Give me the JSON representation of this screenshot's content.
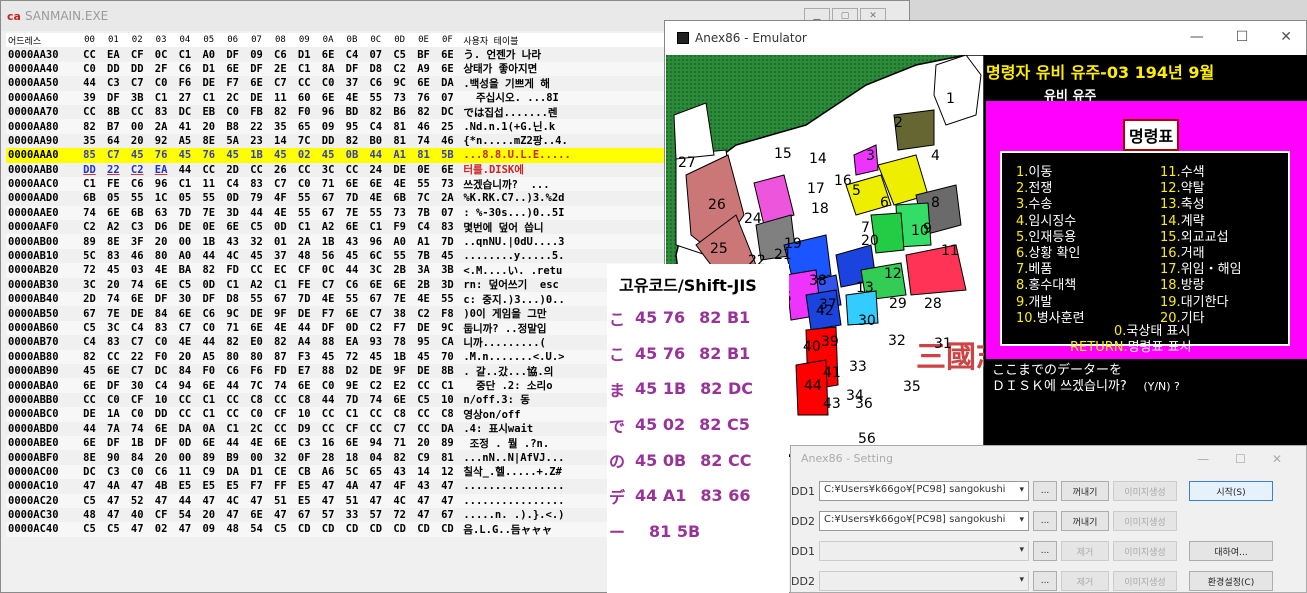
{
  "hexwin": {
    "title": "SANMAIN.EXE",
    "logo": "ca",
    "header": {
      "addr": "어드레스",
      "cols": [
        "00",
        "01",
        "02",
        "03",
        "04",
        "05",
        "06",
        "07",
        "08",
        "09",
        "0A",
        "0B",
        "0C",
        "0D",
        "0E",
        "0F"
      ],
      "ascii": "사용자 테이블"
    },
    "rows": [
      {
        "addr": "0000AA30",
        "b": [
          "CC",
          "EA",
          "CF",
          "0C",
          "C1",
          "A0",
          "DF",
          "09",
          "C6",
          "D1",
          "6E",
          "C4",
          "07",
          "C5",
          "BF",
          "6E"
        ],
        "a": "う. 언젠가 나라"
      },
      {
        "addr": "0000AA40",
        "b": [
          "C0",
          "DD",
          "DD",
          "2F",
          "C6",
          "D1",
          "6E",
          "DF",
          "2E",
          "C1",
          "8A",
          "DF",
          "D8",
          "C2",
          "A9",
          "6E"
        ],
        "a": "상태가 좋아지면"
      },
      {
        "addr": "0000AA50",
        "b": [
          "44",
          "C3",
          "C7",
          "C0",
          "F6",
          "DE",
          "F7",
          "6E",
          "C7",
          "CC",
          "C0",
          "37",
          "C6",
          "9C",
          "6E",
          "DA"
        ],
        "a": ".백성을 기쁘게 해"
      },
      {
        "addr": "0000AA60",
        "b": [
          "39",
          "DF",
          "3B",
          "C1",
          "27",
          "C1",
          "2C",
          "DE",
          "11",
          "60",
          "6E",
          "4E",
          "55",
          "73",
          "76",
          "07"
        ],
        "a": "  주십시오. ...8I"
      },
      {
        "addr": "0000AA70",
        "b": [
          "CC",
          "8B",
          "CC",
          "83",
          "DC",
          "EB",
          "C0",
          "FB",
          "82",
          "F0",
          "96",
          "BD",
          "82",
          "B6",
          "82",
          "DC"
        ],
        "a": "では집섭.......렌"
      },
      {
        "addr": "0000AA80",
        "b": [
          "82",
          "B7",
          "00",
          "2A",
          "41",
          "20",
          "B8",
          "22",
          "35",
          "65",
          "09",
          "95",
          "C4",
          "81",
          "46",
          "25"
        ],
        "a": ".Nd.n.1(+G.닌.k"
      },
      {
        "addr": "0000AA90",
        "b": [
          "35",
          "64",
          "20",
          "92",
          "A5",
          "8E",
          "5A",
          "23",
          "14",
          "7C",
          "DD",
          "82",
          "B0",
          "81",
          "74",
          "46"
        ],
        "a": "{*n.....mZ2팡..4."
      },
      {
        "addr": "0000AAA0",
        "b": [
          "85",
          "C7",
          "45",
          "76",
          "45",
          "76",
          "45",
          "1B",
          "45",
          "02",
          "45",
          "0B",
          "44",
          "A1",
          "81",
          "5B"
        ],
        "a": "...8.8.U.L.E.....",
        "cls": "sel"
      },
      {
        "addr": "0000AAB0",
        "b": [
          "DD",
          "22",
          "C2",
          "EA",
          "44",
          "CC",
          "2D",
          "CC",
          "26",
          "CC",
          "3C",
          "CC",
          "24",
          "DE",
          "0E",
          "6E"
        ],
        "a": "터를.DISK에",
        "cls": "sel2"
      },
      {
        "addr": "0000AAC0",
        "b": [
          "C1",
          "FE",
          "C6",
          "96",
          "C1",
          "11",
          "C4",
          "83",
          "C7",
          "C0",
          "71",
          "6E",
          "6E",
          "4E",
          "55",
          "73"
        ],
        "a": "쓰겠습니까?  ..."
      },
      {
        "addr": "0000AAD0",
        "b": [
          "6B",
          "05",
          "55",
          "1C",
          "05",
          "55",
          "0D",
          "79",
          "4F",
          "55",
          "67",
          "7D",
          "4E",
          "6B",
          "7C",
          "2A"
        ],
        "a": "%K.RK.C7..)3.%2d"
      },
      {
        "addr": "0000AAE0",
        "b": [
          "74",
          "6E",
          "6B",
          "63",
          "7D",
          "7E",
          "3D",
          "44",
          "4E",
          "55",
          "67",
          "7E",
          "55",
          "73",
          "7B",
          "07"
        ],
        "a": ": %-30s...)0..5I"
      },
      {
        "addr": "0000AAF0",
        "b": [
          "C2",
          "A2",
          "C3",
          "D6",
          "DE",
          "0E",
          "6E",
          "C5",
          "0D",
          "C1",
          "A2",
          "6E",
          "C1",
          "F9",
          "C4",
          "83"
        ],
        "a": "몇번에 덮어 씁니"
      },
      {
        "addr": "0000AB00",
        "b": [
          "89",
          "8E",
          "3F",
          "20",
          "00",
          "1B",
          "43",
          "32",
          "01",
          "2A",
          "1B",
          "43",
          "96",
          "A0",
          "A1",
          "7D"
        ],
        "a": "..qnNU.|0dU....3"
      },
      {
        "addr": "0000AB10",
        "b": [
          "5C",
          "83",
          "46",
          "80",
          "A0",
          "44",
          "4C",
          "45",
          "37",
          "48",
          "56",
          "45",
          "6C",
          "55",
          "7B",
          "45"
        ],
        "a": "........y.....5."
      },
      {
        "addr": "0000AB20",
        "b": [
          "72",
          "45",
          "03",
          "4E",
          "BA",
          "82",
          "FD",
          "CC",
          "EC",
          "CF",
          "0C",
          "44",
          "3C",
          "2B",
          "3A",
          "3B"
        ],
        "a": "<.M....い. .retu"
      },
      {
        "addr": "0000AB30",
        "b": [
          "3C",
          "20",
          "74",
          "6E",
          "C5",
          "0D",
          "C1",
          "A2",
          "C1",
          "FE",
          "C7",
          "C6",
          "6E",
          "6E",
          "2B",
          "3D"
        ],
        "a": "rn: 덮어쓰기  esc"
      },
      {
        "addr": "0000AB40",
        "b": [
          "2D",
          "74",
          "6E",
          "DF",
          "30",
          "DF",
          "D8",
          "55",
          "67",
          "7D",
          "4E",
          "55",
          "67",
          "7E",
          "4E",
          "55"
        ],
        "a": "c: 중지.)3...)0.."
      },
      {
        "addr": "0000AB50",
        "b": [
          "67",
          "7E",
          "DE",
          "84",
          "6E",
          "C6",
          "9C",
          "DE",
          "9F",
          "DE",
          "F7",
          "6E",
          "C7",
          "38",
          "C2",
          "F8"
        ],
        "a": ")0이 게임을 그만"
      },
      {
        "addr": "0000AB60",
        "b": [
          "C5",
          "3C",
          "C4",
          "83",
          "C7",
          "C0",
          "71",
          "6E",
          "4E",
          "44",
          "DF",
          "0D",
          "C2",
          "F7",
          "DE",
          "9C"
        ],
        "a": "둡니까? ..정말입"
      },
      {
        "addr": "0000AB70",
        "b": [
          "C4",
          "83",
          "C7",
          "C0",
          "4E",
          "44",
          "82",
          "E0",
          "82",
          "A4",
          "88",
          "EA",
          "93",
          "78",
          "95",
          "CA"
        ],
        "a": "니까.........("
      },
      {
        "addr": "0000AB80",
        "b": [
          "82",
          "CC",
          "22",
          "F0",
          "20",
          "A5",
          "80",
          "80",
          "87",
          "F3",
          "45",
          "72",
          "45",
          "1B",
          "45",
          "70"
        ],
        "a": ".M.n.......<.U.>"
      },
      {
        "addr": "0000AB90",
        "b": [
          "45",
          "6E",
          "C7",
          "DC",
          "84",
          "F0",
          "C6",
          "F6",
          "FD",
          "E7",
          "88",
          "D2",
          "DE",
          "9F",
          "DE",
          "8B"
        ],
        "a": ". 갈..갔...協.의"
      },
      {
        "addr": "0000ABA0",
        "b": [
          "6E",
          "DF",
          "30",
          "C4",
          "94",
          "6E",
          "44",
          "7C",
          "74",
          "6E",
          "C0",
          "9E",
          "C2",
          "E2",
          "CC",
          "C1"
        ],
        "a": "  중단 .2: 소리o"
      },
      {
        "addr": "0000ABB0",
        "b": [
          "CC",
          "C0",
          "CF",
          "10",
          "CC",
          "C1",
          "CC",
          "C8",
          "CC",
          "C8",
          "44",
          "7D",
          "74",
          "6E",
          "C5",
          "10"
        ],
        "a": "n/off.3: 동"
      },
      {
        "addr": "0000ABC0",
        "b": [
          "DE",
          "1A",
          "C0",
          "DD",
          "CC",
          "C1",
          "CC",
          "C0",
          "CF",
          "10",
          "CC",
          "C1",
          "CC",
          "C8",
          "CC",
          "C8"
        ],
        "a": "영상on/off"
      },
      {
        "addr": "0000ABD0",
        "b": [
          "44",
          "7A",
          "74",
          "6E",
          "DA",
          "0A",
          "C1",
          "2C",
          "CC",
          "D9",
          "CC",
          "CF",
          "CC",
          "C7",
          "CC",
          "DA"
        ],
        "a": ".4: 표시wait"
      },
      {
        "addr": "0000ABE0",
        "b": [
          "6E",
          "DF",
          "1B",
          "DF",
          "0D",
          "6E",
          "44",
          "4E",
          "6E",
          "C3",
          "16",
          "6E",
          "94",
          "71",
          "20",
          "89"
        ],
        "a": " 조정 . 뭘 .?n."
      },
      {
        "addr": "0000ABF0",
        "b": [
          "8E",
          "90",
          "84",
          "20",
          "00",
          "89",
          "B9",
          "00",
          "32",
          "0F",
          "28",
          "18",
          "04",
          "82",
          "C9",
          "81"
        ],
        "a": "...nN..N|AfVJ..."
      },
      {
        "addr": "0000AC00",
        "b": [
          "DC",
          "C3",
          "C0",
          "C6",
          "11",
          "C9",
          "DA",
          "D1",
          "CE",
          "CB",
          "A6",
          "5C",
          "65",
          "43",
          "14",
          "12"
        ],
        "a": "칠삭_.헬.....+.Z#"
      },
      {
        "addr": "0000AC10",
        "b": [
          "47",
          "4A",
          "47",
          "4B",
          "E5",
          "E5",
          "E5",
          "F7",
          "FF",
          "E5",
          "47",
          "4A",
          "47",
          "4F",
          "43",
          "47"
        ],
        "a": "................"
      },
      {
        "addr": "0000AC20",
        "b": [
          "C5",
          "47",
          "52",
          "47",
          "44",
          "47",
          "4C",
          "47",
          "51",
          "E5",
          "47",
          "51",
          "47",
          "4C",
          "47",
          "47"
        ],
        "a": "................"
      },
      {
        "addr": "0000AC30",
        "b": [
          "48",
          "47",
          "40",
          "CF",
          "54",
          "20",
          "47",
          "6E",
          "47",
          "67",
          "57",
          "33",
          "57",
          "72",
          "47",
          "67"
        ],
        "a": ".....n. .).}.<.)"
      },
      {
        "addr": "0000AC40",
        "b": [
          "C5",
          "C5",
          "47",
          "02",
          "47",
          "09",
          "48",
          "54",
          "C5",
          "CD",
          "CD",
          "CD",
          "CD",
          "CD",
          "CD",
          "CD"
        ],
        "a": "음.L.G..듬ャャャ"
      }
    ]
  },
  "emulator": {
    "title": "Anex86 - Emulator",
    "hud_line1": "명령자 유비  유주-03  194년  9월",
    "hud_line2": "유비    유주",
    "menu_title": "명령표",
    "menu_left": [
      {
        "n": "1.",
        "t": "이동"
      },
      {
        "n": "2.",
        "t": "전쟁"
      },
      {
        "n": "3.",
        "t": "수송"
      },
      {
        "n": "4.",
        "t": "임시징수"
      },
      {
        "n": "5.",
        "t": "인재등용"
      },
      {
        "n": "6.",
        "t": "상황 확인"
      },
      {
        "n": "7.",
        "t": "베품"
      },
      {
        "n": "8.",
        "t": "홍수대책"
      },
      {
        "n": "9.",
        "t": "개발"
      },
      {
        "n": "10.",
        "t": "병사훈련"
      }
    ],
    "menu_right": [
      {
        "n": "11.",
        "t": "수색"
      },
      {
        "n": "12.",
        "t": "약탈"
      },
      {
        "n": "13.",
        "t": "축성"
      },
      {
        "n": "14.",
        "t": "계략"
      },
      {
        "n": "15.",
        "t": "외교교섭"
      },
      {
        "n": "16.",
        "t": "거래"
      },
      {
        "n": "17.",
        "t": "위임・해임"
      },
      {
        "n": "18.",
        "t": "방랑"
      },
      {
        "n": "19.",
        "t": "대기한다"
      },
      {
        "n": "20.",
        "t": "기타"
      }
    ],
    "menu_zero": {
      "n": "0.",
      "t": "국상태 표시"
    },
    "menu_return": {
      "n": "RETURN.",
      "t": "명령표 표시"
    },
    "msg1": "ここまでのデーターを",
    "msg2": "ＤＩＳＫ에 쓰겠습니까?",
    "msg_yn": "(Y/N) ?",
    "map_title": "三國志",
    "provinces": [
      "1",
      "2",
      "3",
      "4",
      "5",
      "6",
      "7",
      "8",
      "9",
      "10",
      "11",
      "12",
      "13",
      "14",
      "15",
      "16",
      "17",
      "18",
      "19",
      "20",
      "21",
      "22",
      "23",
      "24",
      "25",
      "26",
      "27",
      "28",
      "29",
      "30",
      "31",
      "32",
      "33",
      "34",
      "35",
      "36",
      "37",
      "38",
      "39",
      "40",
      "41",
      "42",
      "43",
      "44",
      "45",
      "56"
    ]
  },
  "setting": {
    "title": "Anex86 - Setting",
    "rows": [
      {
        "label": "DD1",
        "value": "C:¥Users¥k66go¥[PC98] sangokushi",
        "b1": "꺼내기",
        "b2": "이미지생성",
        "b3": "시작(S)"
      },
      {
        "label": "DD2",
        "value": "C:¥Users¥k66go¥[PC98] sangokushi",
        "b1": "꺼내기",
        "b2": "이미지생성",
        "b3": ""
      },
      {
        "label": "DD1",
        "value": "",
        "b1": "제거",
        "b2": "이미지생성",
        "b3": "대하여..."
      },
      {
        "label": "DD2",
        "value": "",
        "b1": "제거",
        "b2": "이미지생성",
        "b3": "환경설정(C)"
      }
    ]
  },
  "codes": {
    "header": "고유코드/Shift-JIS",
    "rows": [
      {
        "ch": "こ",
        "u": "45 76",
        "s": "82 B1"
      },
      {
        "ch": "こ",
        "u": "45 76",
        "s": "82 B1"
      },
      {
        "ch": "ま",
        "u": "45 1B",
        "s": "82 DC"
      },
      {
        "ch": "で",
        "u": "45 02",
        "s": "82 C5"
      },
      {
        "ch": "の",
        "u": "45 0B",
        "s": "82 CC"
      },
      {
        "ch": "デ",
        "u": "44 A1",
        "s": "83 66"
      },
      {
        "ch": "ー",
        "u": "",
        "s": "81 5B"
      }
    ]
  }
}
